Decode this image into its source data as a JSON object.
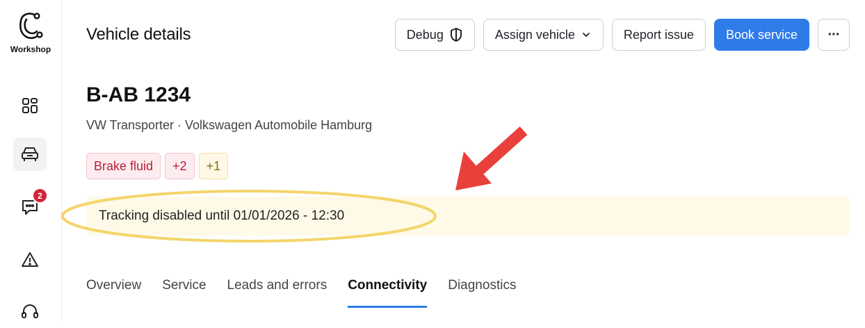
{
  "sidebar": {
    "logo_label": "Workshop",
    "items": [
      {
        "icon": "dashboard-icon"
      },
      {
        "icon": "car-icon",
        "active": true
      },
      {
        "icon": "chat-icon",
        "badge": "2"
      },
      {
        "icon": "warning-icon"
      },
      {
        "icon": "headset-icon"
      }
    ]
  },
  "header": {
    "title": "Vehicle details",
    "buttons": {
      "debug": "Debug",
      "assign": "Assign vehicle",
      "report": "Report issue",
      "book": "Book service",
      "more": "···"
    }
  },
  "vehicle": {
    "plate": "B-AB 1234",
    "subtitle": "VW Transporter · Volkswagen Automobile Hamburg",
    "tags": [
      {
        "label": "Brake fluid",
        "tone": "red"
      },
      {
        "label": "+2",
        "tone": "red"
      },
      {
        "label": "+1",
        "tone": "yellow"
      }
    ]
  },
  "banner": {
    "text": "Tracking disabled until 01/01/2026 - 12:30"
  },
  "tabs": [
    {
      "label": "Overview"
    },
    {
      "label": "Service"
    },
    {
      "label": "Leads and errors"
    },
    {
      "label": "Connectivity",
      "active": true
    },
    {
      "label": "Diagnostics"
    }
  ],
  "colors": {
    "accent": "#2f7be8",
    "badge": "#d1243a",
    "annotation_arrow": "#e8403a",
    "annotation_ellipse": "#f3d56a",
    "banner_bg": "#fffae8"
  }
}
